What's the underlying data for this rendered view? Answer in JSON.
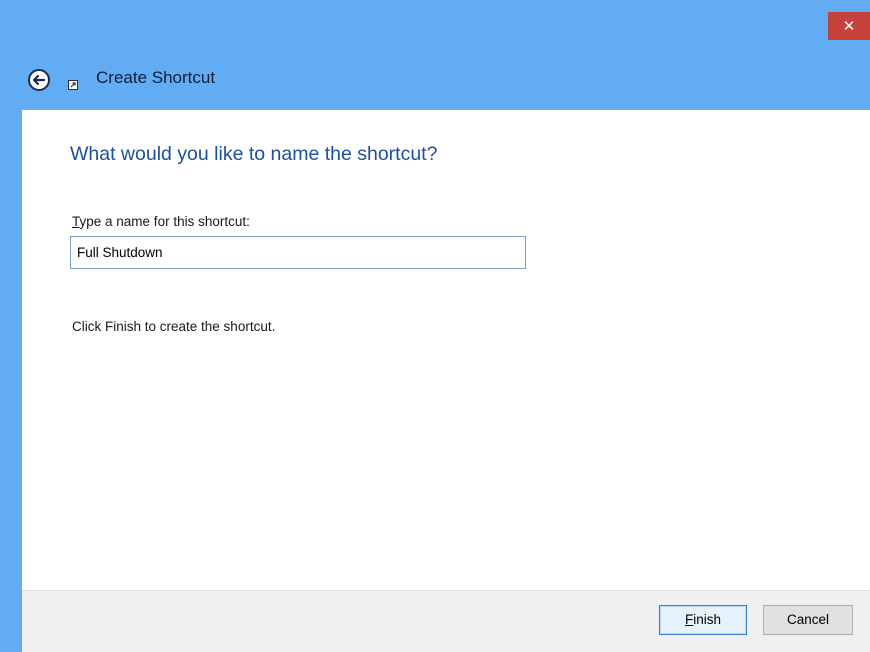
{
  "titlebar": {
    "close_label": "✕",
    "close_color": "#c7423a"
  },
  "header": {
    "back_icon": "back-arrow-icon",
    "shortcut_icon": "shortcut-icon",
    "title": "Create Shortcut"
  },
  "main": {
    "question": "What would you like to name the shortcut?",
    "field_label_accel": "T",
    "field_label_rest": "ype a name for this shortcut:",
    "name_value": "Full Shutdown",
    "hint": "Click Finish to create the shortcut."
  },
  "footer": {
    "finish_accel": "F",
    "finish_rest": "inish",
    "cancel_label": "Cancel"
  },
  "colors": {
    "window_frame": "#62acf4",
    "question_text": "#1e4fa6",
    "footer_bg": "#f0f0f0"
  }
}
